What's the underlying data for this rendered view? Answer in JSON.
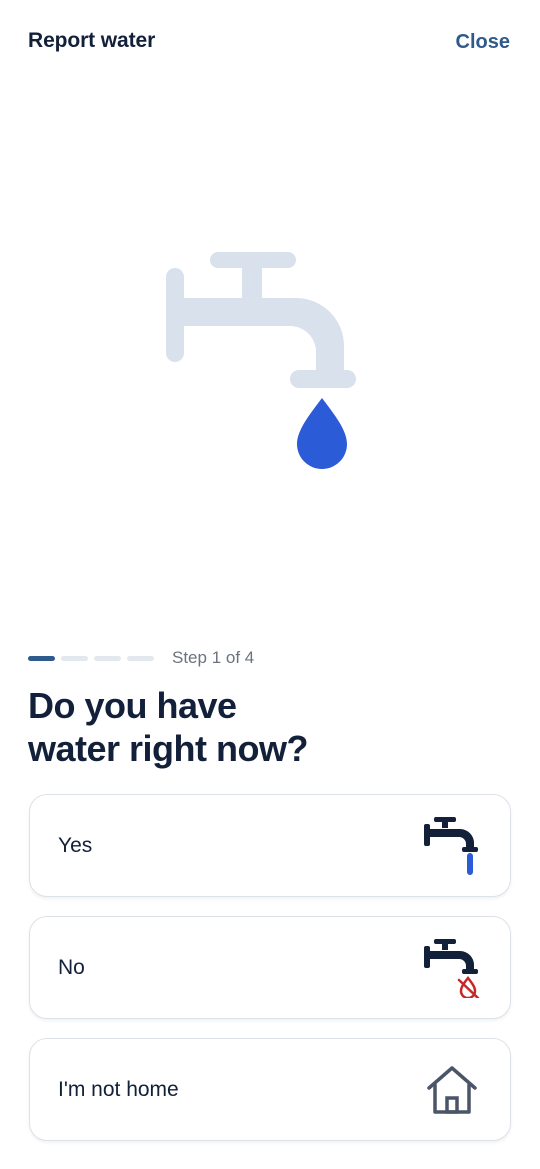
{
  "header": {
    "title": "Report water",
    "close_label": "Close"
  },
  "progress": {
    "current_step": 1,
    "total_steps": 4,
    "label": "Step 1 of 4"
  },
  "question": {
    "line1": "Do you have",
    "line2": "water right now?"
  },
  "options": [
    {
      "label": "Yes",
      "icon": "faucet-running-icon"
    },
    {
      "label": "No",
      "icon": "faucet-no-water-icon"
    },
    {
      "label": "I'm not home",
      "icon": "house-icon"
    }
  ],
  "colors": {
    "accent": "#2f5a8c",
    "drop": "#2b5bd6",
    "faucet_light": "#d9e1ec",
    "no_water": "#c62828",
    "text": "#13203a"
  }
}
